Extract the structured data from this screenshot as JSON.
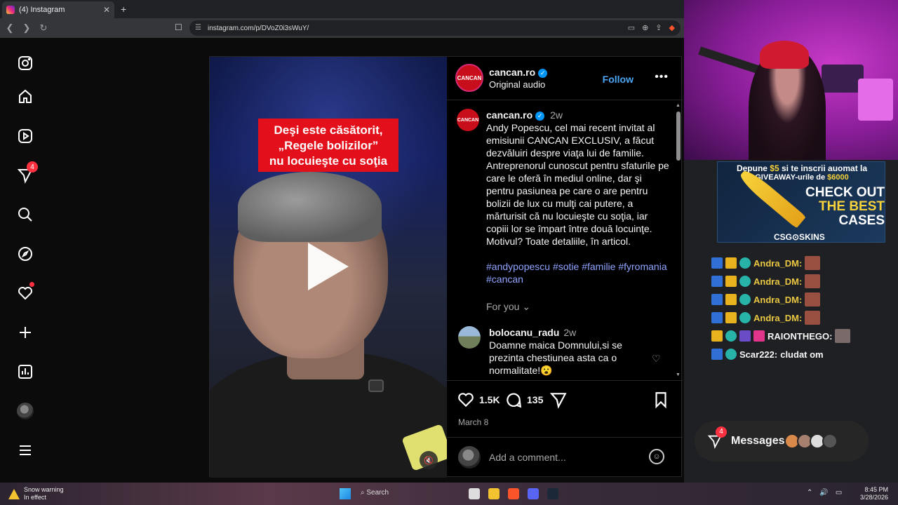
{
  "browser": {
    "tab_title": "(4) Instagram",
    "tab_close": "✕",
    "new_tab": "+",
    "url": "instagram.com/p/DVoZ0i3sWuY/"
  },
  "sidebar": {
    "notifications_badge": "4"
  },
  "video": {
    "caption_lines": [
      "Deşi este căsătorit,",
      "„Regele bolizilor”",
      "nu locuieşte cu soţia"
    ]
  },
  "post": {
    "author": "cancan.ro",
    "avatar_text": "CANCAN",
    "audio": "Original audio",
    "follow_label": "Follow",
    "more_label": "•••",
    "time": "2w",
    "caption": "Andy Popescu, cel mai recent invitat al emisiunii CANCAN EXCLUSIV, a făcut dezvăluiri despre viaţa lui de familie. Antreprenorul cunoscut pentru sfaturile pe care le oferă în mediul online, dar şi pentru pasiunea pe care o are pentru bolizii de lux cu mulţi cai putere, a mărturisit că nu locuieşte cu soţia, iar copiii lor se împart între două locuinţe. Motivul? Toate detaliile, în articol.",
    "hashtags": "#andypopescu #sotie #familie #fyromania #cancan",
    "for_you": "For you",
    "comment": {
      "user": "bolocanu_radu",
      "time": "2w",
      "text": "Doamne maica Domnului,si se prezinta chestiunea asta ca o normalitate!😮"
    },
    "likes": "1.5K",
    "comments_count": "135",
    "date": "March 8",
    "add_comment_placeholder": "Add a comment..."
  },
  "ad": {
    "line1_a": "Depune ",
    "line1_b": "$5",
    "line1_c": " si te inscrii auomat la",
    "line2_a": "GIVEAWAY-urile de ",
    "line2_b": "$6000",
    "big1": "CHECK OUT",
    "big2": "THE BEST",
    "big3": "CASES",
    "brand": "CSG⊙SKINS"
  },
  "chat": [
    {
      "name": "Andra_DM:",
      "text": ""
    },
    {
      "name": "Andra_DM:",
      "text": ""
    },
    {
      "name": "Andra_DM:",
      "text": ""
    },
    {
      "name": "Andra_DM:",
      "text": ""
    },
    {
      "name": "RAIONTHEGO:",
      "text": ""
    },
    {
      "name": "Scar222:",
      "text": "cludat om"
    }
  ],
  "messages": {
    "label": "Messages",
    "badge": "4"
  },
  "taskbar": {
    "weather_title": "Snow warning",
    "weather_sub": "In effect",
    "search": "Search",
    "time": "8:45 PM",
    "date": "3/28/2026"
  },
  "colors": {
    "accent_blue": "#0095f6",
    "follow_blue": "#4aa6f7",
    "badge_red": "#ff3040",
    "caption_red": "#e3101b"
  }
}
